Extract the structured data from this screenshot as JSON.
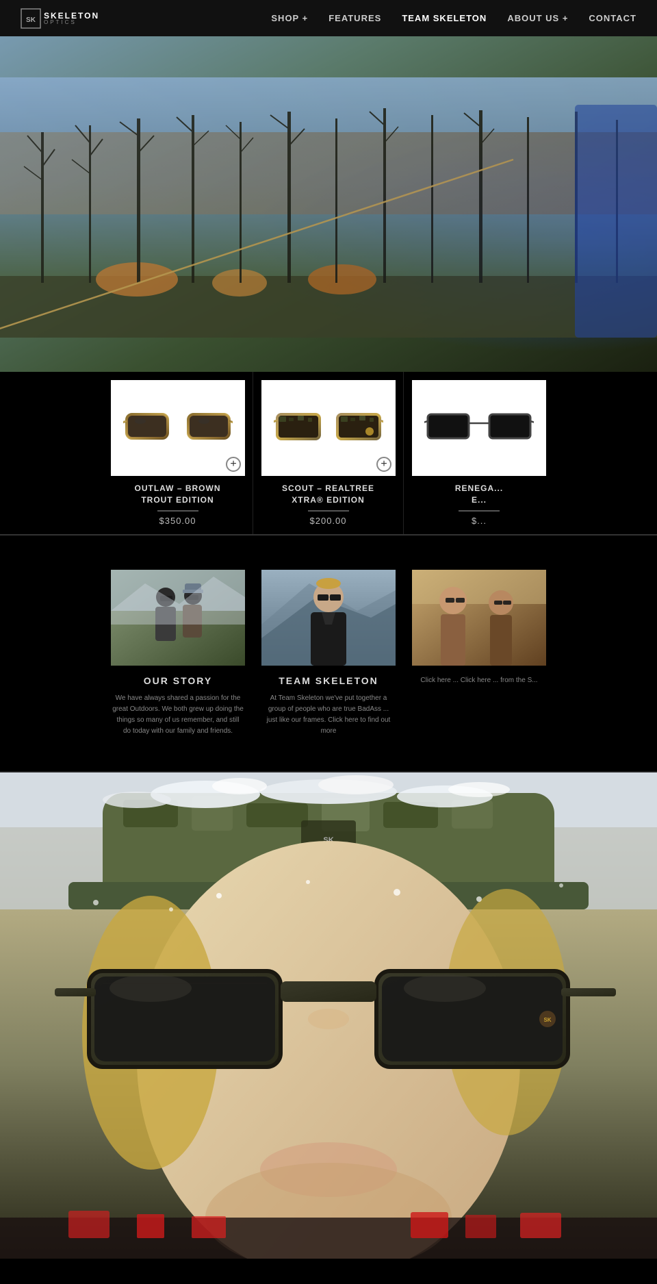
{
  "navbar": {
    "logo": "SKELETON",
    "logo_sub": "OPTICS",
    "nav_items": [
      {
        "label": "SHOP +",
        "id": "shop"
      },
      {
        "label": "FEATURES",
        "id": "features"
      },
      {
        "label": "TEAM SKELETON",
        "id": "team-skeleton"
      },
      {
        "label": "ABOUT US +",
        "id": "about"
      },
      {
        "label": "CONTACT",
        "id": "contact"
      }
    ]
  },
  "products": [
    {
      "id": "outlaw",
      "name": "OUTLAW – BROWN\nTROUT EDITION",
      "price": "$350.00",
      "has_add": true
    },
    {
      "id": "scout",
      "name": "SCOUT – REALTREE\nXTRA® EDITION",
      "price": "$200.00",
      "has_add": true
    },
    {
      "id": "renegade",
      "name": "RENEGA...\nE...",
      "price": "$...",
      "has_add": false
    }
  ],
  "sections": [
    {
      "id": "our-story",
      "title": "OUR STORY",
      "text": "We have always shared a passion for the great Outdoors. We both grew up doing the things so many of us remember, and still do today with our family and friends."
    },
    {
      "id": "team-skeleton",
      "title": "TEAM SKELETON",
      "text": "At Team Skeleton we've put together a group of people who are true BadAss ... just like our frames. Click here to find out more"
    },
    {
      "id": "third",
      "title": "",
      "text": "Click here ... Click here ... from the S..."
    }
  ]
}
